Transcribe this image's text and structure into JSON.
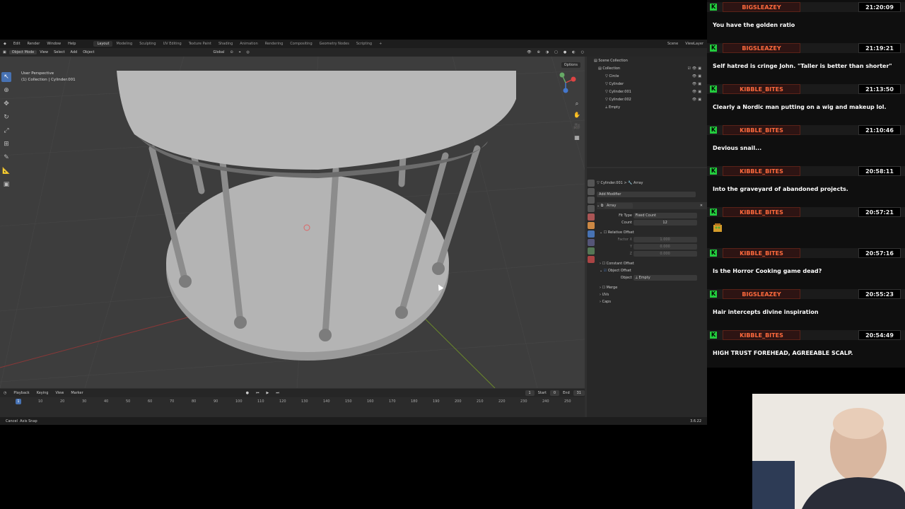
{
  "blender": {
    "menu": [
      "Edit",
      "Render",
      "Window",
      "Help"
    ],
    "workspaces": [
      "Layout",
      "Modeling",
      "Sculpting",
      "UV Editing",
      "Texture Paint",
      "Shading",
      "Animation",
      "Rendering",
      "Compositing",
      "Geometry Nodes",
      "Scripting"
    ],
    "active_workspace": "Layout",
    "scene_label": "Scene",
    "viewlayer_label": "ViewLayer",
    "toolbar": {
      "mode": "Object Mode",
      "view": "View",
      "select": "Select",
      "add": "Add",
      "object": "Object",
      "orientation": "Global",
      "options": "Options"
    },
    "viewport": {
      "perspective": "User Perspective",
      "collection_info": "(1) Collection | Cylinder.001"
    },
    "outliner": {
      "scene_collection": "Scene Collection",
      "collection": "Collection",
      "items": [
        "Circle",
        "Cylinder",
        "Cylinder.001",
        "Cylinder.002",
        "Empty"
      ]
    },
    "properties": {
      "breadcrumb_object": "Cylinder.001",
      "breadcrumb_modifier": "Array",
      "add_modifier": "Add Modifier",
      "modifier_name": "Array",
      "fit_type_label": "Fit Type",
      "fit_type_value": "Fixed Count",
      "count_label": "Count",
      "count_value": "12",
      "relative_offset": "Relative Offset",
      "factor_x_label": "Factor X",
      "factor_x": "1.000",
      "y_label": "Y",
      "factor_y": "0.000",
      "z_label": "Z",
      "factor_z": "0.000",
      "constant_offset": "Constant Offset",
      "object_offset": "Object Offset",
      "object_label": "Object",
      "object_value": "Empty",
      "merge": "Merge",
      "uvs": "UVs",
      "caps": "Caps"
    },
    "timeline": {
      "playback": "Playback",
      "keying": "Keying",
      "view": "View",
      "marker": "Marker",
      "current_frame": "1",
      "start_label": "Start",
      "start_value": "0",
      "end_label": "End",
      "end_value": "31",
      "ticks": [
        "1",
        "10",
        "20",
        "30",
        "40",
        "50",
        "60",
        "70",
        "80",
        "90",
        "100",
        "110",
        "120",
        "130",
        "140",
        "150",
        "160",
        "170",
        "180",
        "190",
        "200",
        "210",
        "220",
        "230",
        "240",
        "250"
      ]
    },
    "status": {
      "cancel": "Cancel",
      "axis_snap": "Axis Snap",
      "version": "3.6.22"
    }
  },
  "chat": [
    {
      "user": "BIGSLEAZEY",
      "time": "21:20:09",
      "text": "You have the golden ratio"
    },
    {
      "user": "BIGSLEAZEY",
      "time": "21:19:21",
      "text": "Self hatred is cringe John. \"Taller is better than shorter\""
    },
    {
      "user": "KIBBLE_BITES",
      "time": "21:13:50",
      "text": "Clearly a Nordic man putting on a wig and makeup lol."
    },
    {
      "user": "KIBBLE_BITES",
      "time": "21:10:46",
      "text": "Devious snail..."
    },
    {
      "user": "KIBBLE_BITES",
      "time": "20:58:11",
      "text": "Into the graveyard of abandoned projects."
    },
    {
      "user": "KIBBLE_BITES",
      "time": "20:57:21",
      "text": "",
      "emote": true
    },
    {
      "user": "KIBBLE_BITES",
      "time": "20:57:16",
      "text": "Is the Horror Cooking game dead?"
    },
    {
      "user": "BIGSLEAZEY",
      "time": "20:55:23",
      "text": "Hair intercepts divine inspiration"
    },
    {
      "user": "KIBBLE_BITES",
      "time": "20:54:49",
      "text": "HIGH TRUST FOREHEAD, AGREEABLE SCALP."
    }
  ],
  "colors": {
    "kick_green": "#23cc3e",
    "username_orange": "#ff6a3d",
    "blender_bg": "#303030",
    "viewport_bg": "#3d3d3d",
    "active_blue": "#4772b3"
  }
}
